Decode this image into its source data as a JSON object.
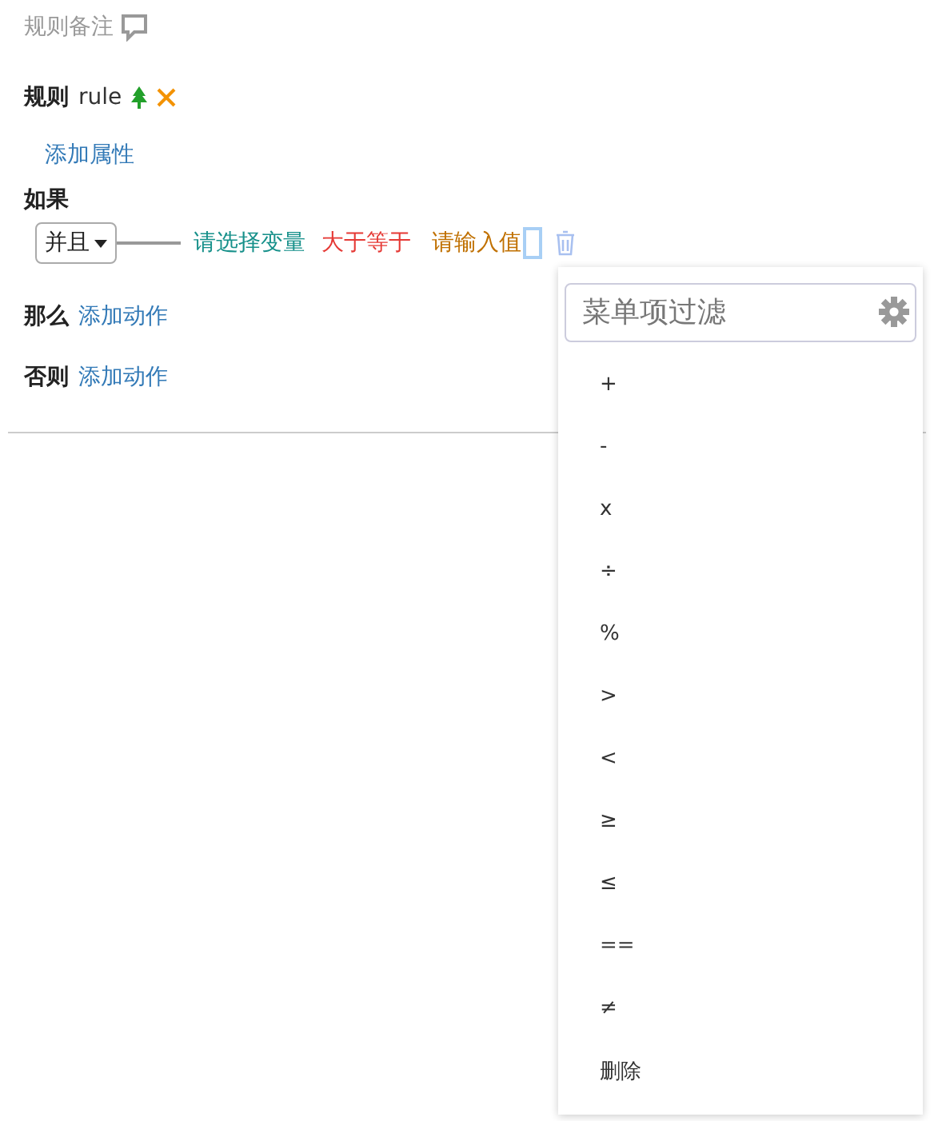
{
  "remark": {
    "label": "规则备注"
  },
  "rule": {
    "label": "规则",
    "name": "rule"
  },
  "add_property": "添加属性",
  "if": {
    "label": "如果",
    "join": "并且",
    "variable": "请选择变量",
    "operator": "大于等于",
    "value_placeholder": "请输入值"
  },
  "then": {
    "label": "那么",
    "action": "添加动作"
  },
  "else": {
    "label": "否则",
    "action": "添加动作"
  },
  "menu": {
    "filter_placeholder": "菜单项过滤",
    "items": [
      "+",
      "-",
      "x",
      "÷",
      "%",
      ">",
      "<",
      "≥",
      "≤",
      "==",
      "≠",
      "删除"
    ]
  }
}
